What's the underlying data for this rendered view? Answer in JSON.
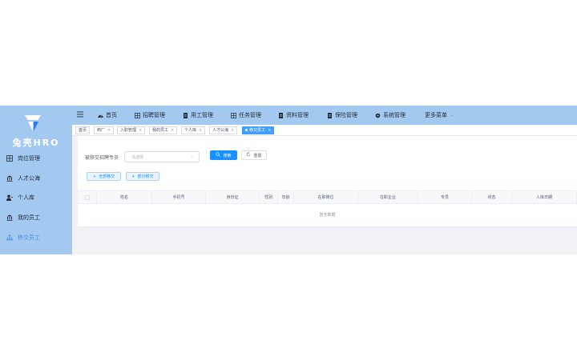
{
  "brand": {
    "name": "兔壳HRO"
  },
  "sidebar": {
    "items": [
      {
        "label": "岗位管理",
        "icon": "grid-icon"
      },
      {
        "label": "人才公海",
        "icon": "bank-icon"
      },
      {
        "label": "个人库",
        "icon": "user-icon"
      },
      {
        "label": "我的员工",
        "icon": "bank-icon"
      },
      {
        "label": "移交员工",
        "icon": "tree-icon",
        "active": true
      }
    ]
  },
  "topmenu": {
    "items": [
      {
        "label": "首页",
        "icon": "dashboard-icon"
      },
      {
        "label": "招聘管理",
        "icon": "grid-icon"
      },
      {
        "label": "用工管理",
        "icon": "doc-icon"
      },
      {
        "label": "任务管理",
        "icon": "grid-icon"
      },
      {
        "label": "资料管理",
        "icon": "doc-icon"
      },
      {
        "label": "保险管理",
        "icon": "doc-icon"
      },
      {
        "label": "系统管理",
        "icon": "gear-icon"
      },
      {
        "label": "更多菜单",
        "icon": "chevron-down-icon"
      }
    ]
  },
  "tags": [
    {
      "label": "首页",
      "closable": false
    },
    {
      "label": "到厂",
      "closable": true
    },
    {
      "label": "入职管理",
      "closable": true
    },
    {
      "label": "我的员工",
      "closable": true
    },
    {
      "label": "个人库",
      "closable": true
    },
    {
      "label": "人才公海",
      "closable": true
    },
    {
      "label": "移交员工",
      "closable": true,
      "active": true
    }
  ],
  "form": {
    "label": "被移交招聘专员",
    "placeholder": "请选择",
    "search_label": "搜索",
    "reset_label": "重置",
    "all_transfer_label": "全部移交",
    "part_transfer_label": "部分移交"
  },
  "table": {
    "columns": [
      "姓名",
      "手机号",
      "身份证",
      "性别",
      "年龄",
      "在职岗位",
      "在职企业",
      "专员",
      "状态",
      "入库日期"
    ],
    "empty_text": "暂无数据"
  },
  "colors": {
    "primary": "#1890ff",
    "sidebar_bg": "#a3c9f1",
    "active_nav": "#4a8fe0"
  }
}
